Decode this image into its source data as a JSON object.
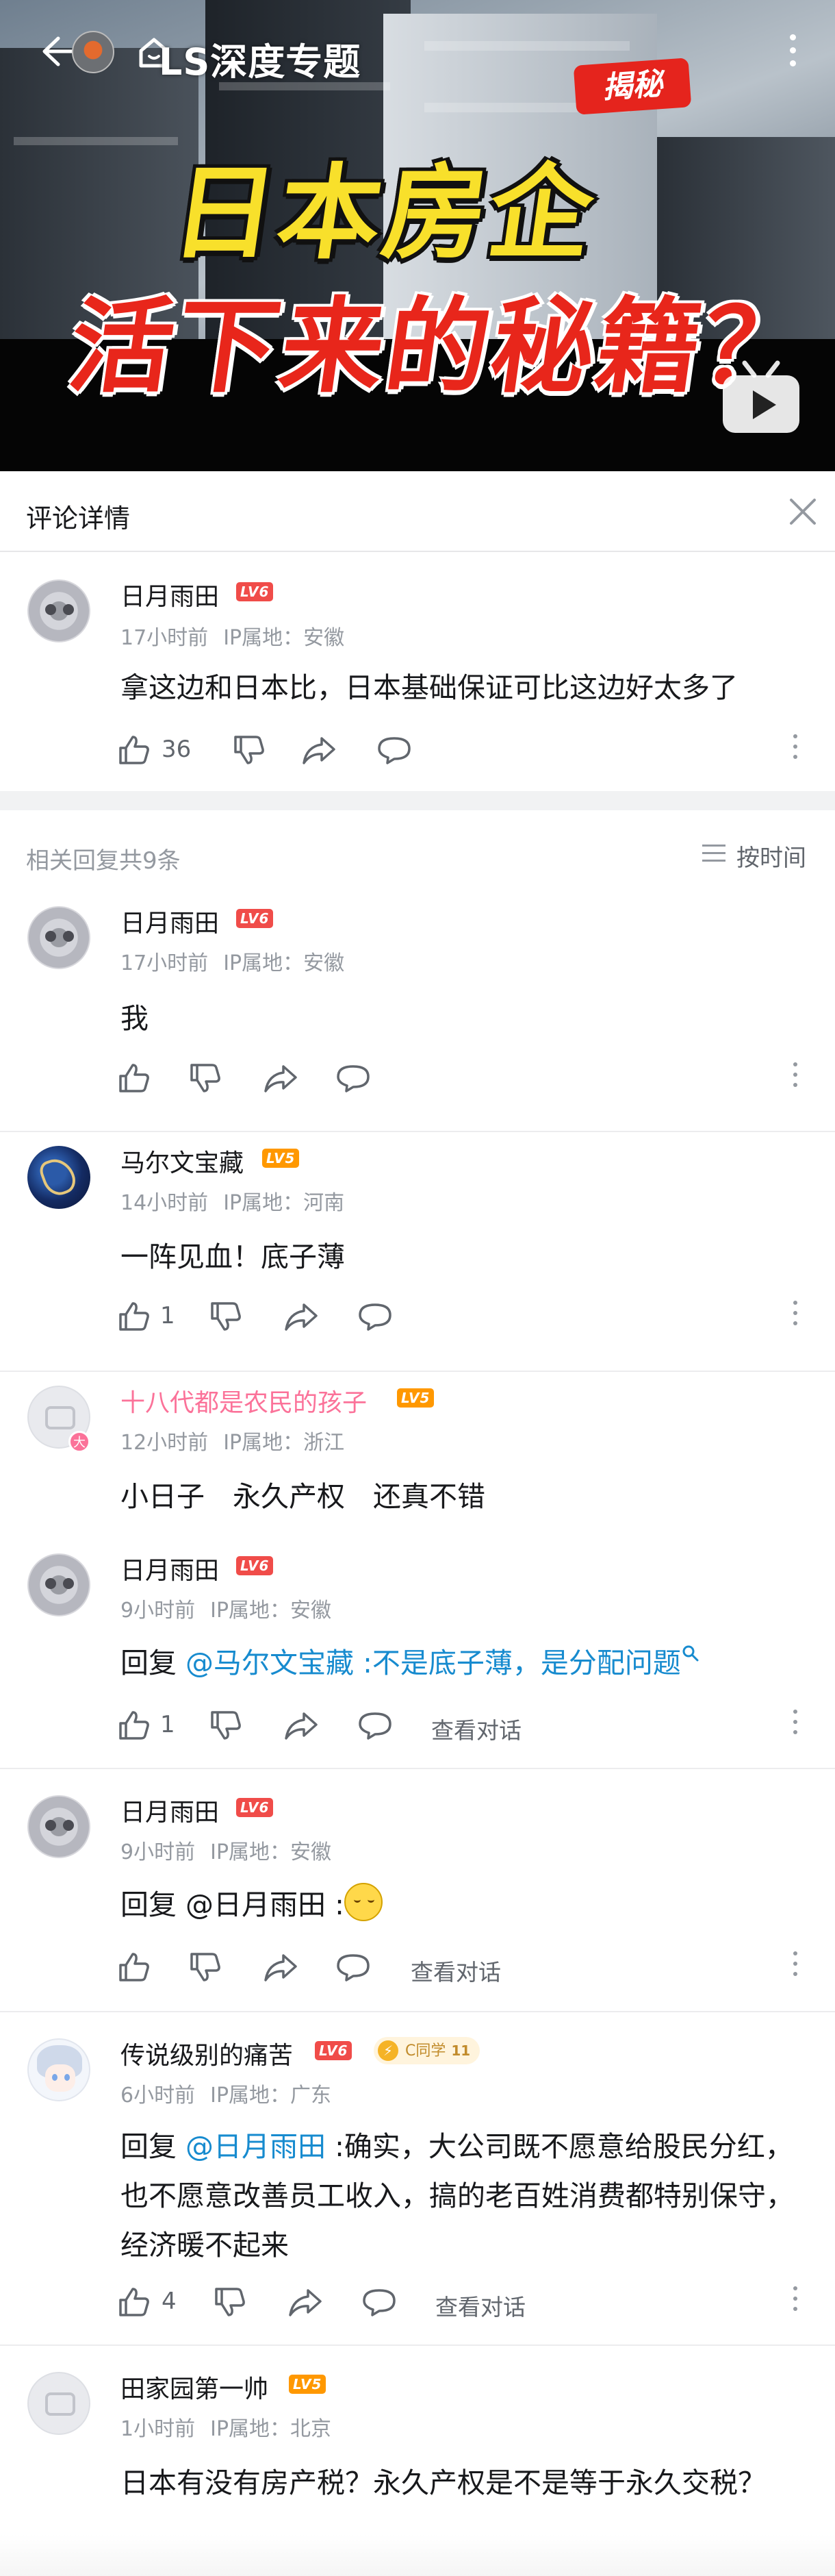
{
  "video": {
    "channel_title": "LS深度专题",
    "badge": "揭秘",
    "headline_line1": "日本房企",
    "headline_line2": "活下来的秘籍？"
  },
  "sheet": {
    "title": "评论详情"
  },
  "root_comment": {
    "username": "日月雨田",
    "level": "LV6",
    "time": "17小时前",
    "ip": "IP属地：安徽",
    "content": "拿这边和日本比，日本基础保证可比这边好太多了",
    "likes": "36"
  },
  "replies_header": {
    "count_label": "相关回复共9条",
    "sort_label": "按时间"
  },
  "replies": [
    {
      "username": "日月雨田",
      "level": "LV6",
      "time": "17小时前",
      "ip": "IP属地：安徽",
      "content": "我",
      "likes": ""
    },
    {
      "username": "马尔文宝藏",
      "level": "LV5",
      "time": "14小时前",
      "ip": "IP属地：河南",
      "content": "一阵见血！底子薄",
      "likes": "1"
    },
    {
      "username": "十八代都是农民的孩子",
      "level": "LV5",
      "time": "12小时前",
      "ip": "IP属地：浙江",
      "content": "小日子　永久产权　还真不错",
      "avatar_badge": "大"
    },
    {
      "username": "日月雨田",
      "level": "LV6",
      "time": "9小时前",
      "ip": "IP属地：安徽",
      "reply_prefix": "回复 ",
      "mention": "@马尔文宝藏",
      "content": " :不是底子薄，是分配问题",
      "likes": "1",
      "view_conversation": "查看对话"
    },
    {
      "username": "日月雨田",
      "level": "LV6",
      "time": "9小时前",
      "ip": "IP属地：安徽",
      "reply_prefix": "回复 ",
      "mention": "@日月雨田",
      "content": " :",
      "likes": "",
      "view_conversation": "查看对话"
    },
    {
      "username": "传说级别的痛苦",
      "level": "LV6",
      "time": "6小时前",
      "ip": "IP属地：广东",
      "honor_badge": "C同学",
      "honor_level": "11",
      "reply_prefix": "回复 ",
      "mention": "@日月雨田",
      "content": " :确实，大公司既不愿意给股民分红，也不愿意改善员工收入，搞的老百姓消费都特别保守，经济暖不起来",
      "likes": "4",
      "view_conversation": "查看对话"
    },
    {
      "username": "田家园第一帅",
      "level": "LV5",
      "time": "1小时前",
      "ip": "IP属地：北京",
      "content": "日本有没有房产税？永久产权是不是等于永久交税？"
    }
  ],
  "colors": {
    "accent_pink": "#fb7299",
    "link_blue": "#178bcf",
    "lv6_red": "#f04c49",
    "lv5_orange": "#ff9800",
    "secondary_text": "#9499a0"
  }
}
